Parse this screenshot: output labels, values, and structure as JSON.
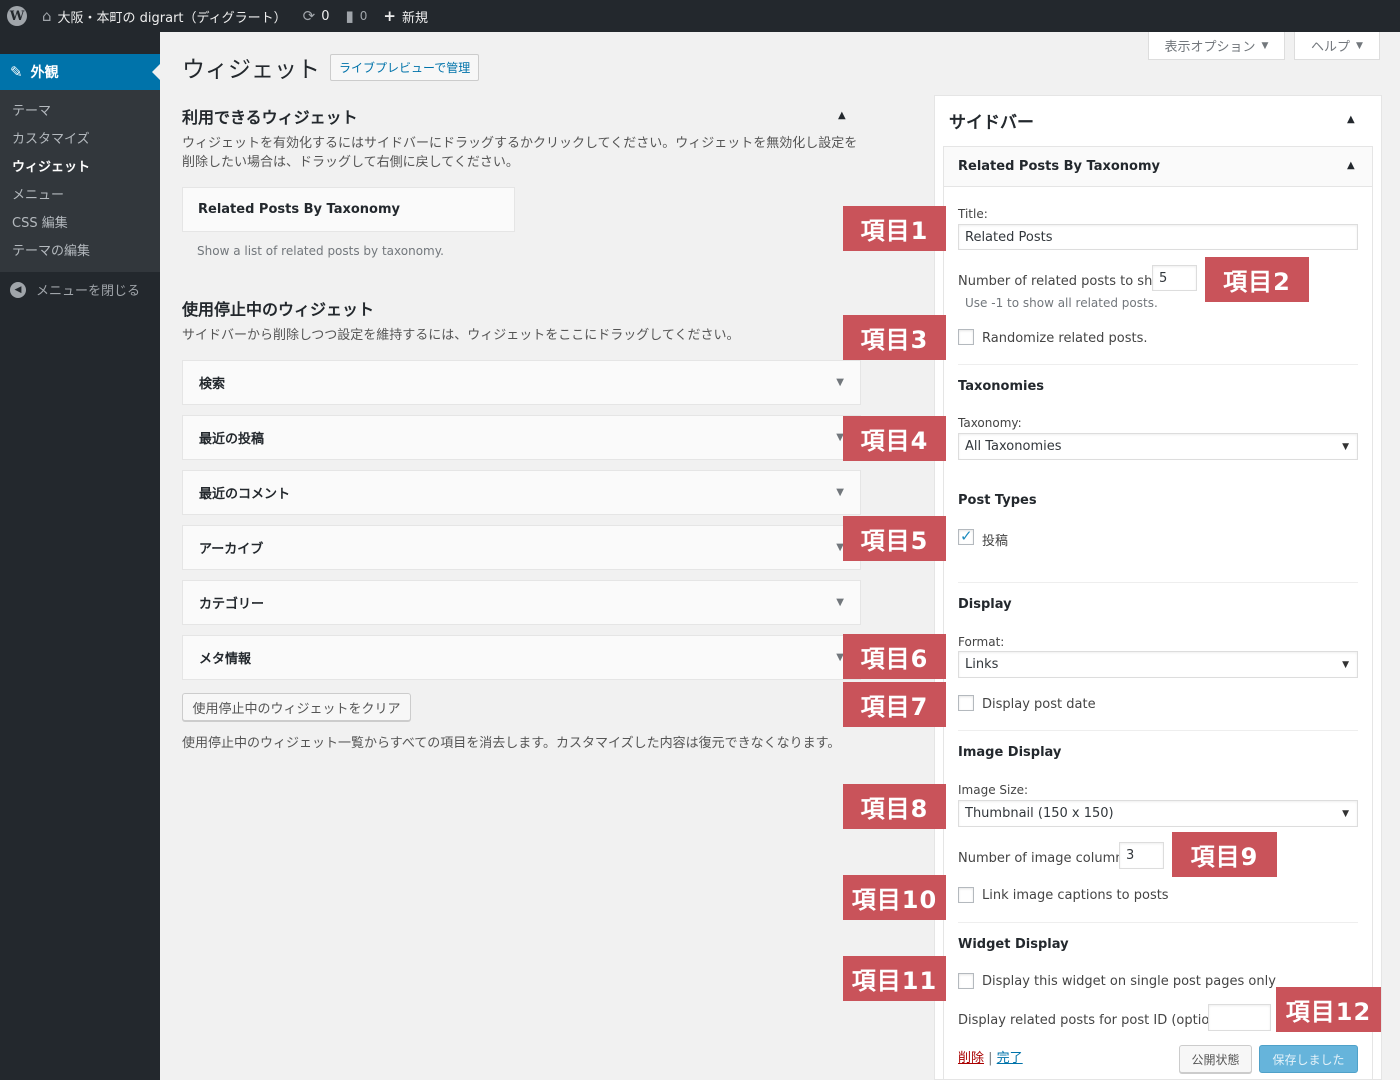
{
  "adminbar": {
    "site_name": "大阪・本町の digrart（ディグラート）",
    "updates_count": "0",
    "comments_count": "0",
    "new_label": "新規"
  },
  "menu": {
    "current": "外観",
    "items": [
      "テーマ",
      "カスタマイズ",
      "ウィジェット",
      "メニュー",
      "CSS 編集",
      "テーマの編集"
    ],
    "current_sub_index": 2,
    "collapse": "メニューを閉じる"
  },
  "screen_options": {
    "display": "表示オプション",
    "help": "ヘルプ"
  },
  "page": {
    "title": "ウィジェット",
    "live_preview": "ライブプレビューで管理"
  },
  "available": {
    "heading": "利用できるウィジェット",
    "desc1": "ウィジェットを有効化するにはサイドバーにドラッグするかクリックしてください。ウィジェットを無効化し設定を",
    "desc2": "削除したい場合は、ドラッグして右側に戻してください。",
    "widget_title": "Related Posts By Taxonomy",
    "widget_desc": "Show a list of related posts by taxonomy."
  },
  "inactive": {
    "heading": "使用停止中のウィジェット",
    "desc": "サイドバーから削除しつつ設定を維持するには、ウィジェットをここにドラッグしてください。",
    "items": [
      "検索",
      "最近の投稿",
      "最近のコメント",
      "アーカイブ",
      "カテゴリー",
      "メタ情報"
    ],
    "clear_button": "使用停止中のウィジェットをクリア",
    "clear_desc": "使用停止中のウィジェット一覧からすべての項目を消去します。カスタマイズした内容は復元できなくなります。"
  },
  "sidebar": {
    "title": "サイドバー",
    "widget_title": "Related Posts By Taxonomy",
    "title_label": "Title:",
    "title_value": "Related Posts",
    "num_label": "Number of related posts to show",
    "num_value": "5",
    "num_hint": "Use -1 to show all related posts.",
    "randomize": "Randomize related posts.",
    "taxonomies_h": "Taxonomies",
    "taxonomy_label": "Taxonomy:",
    "taxonomy_value": "All Taxonomies",
    "post_types_h": "Post Types",
    "post_type_item": "投稿",
    "display_h": "Display",
    "format_label": "Format:",
    "format_value": "Links",
    "display_date": "Display post date",
    "image_display_h": "Image Display",
    "image_size_label": "Image Size:",
    "image_size_value": "Thumbnail (150 x 150)",
    "columns_label": "Number of image columns:",
    "columns_value": "3",
    "link_captions": "Link image captions to posts",
    "widget_display_h": "Widget Display",
    "single_only": "Display this widget on single post pages only",
    "post_id_label": "Display related posts for post ID (optional):",
    "post_id_value": "",
    "delete": "削除",
    "done": "完了",
    "publish_status": "公開状態",
    "saved": "保存しました"
  },
  "tags": [
    "項目1",
    "項目2",
    "項目3",
    "項目4",
    "項目5",
    "項目6",
    "項目7",
    "項目8",
    "項目9",
    "項目10",
    "項目11",
    "項目12"
  ],
  "colors": {
    "accent": "#0073aa",
    "tag": "#c9535a",
    "adminbar": "#23282d"
  }
}
